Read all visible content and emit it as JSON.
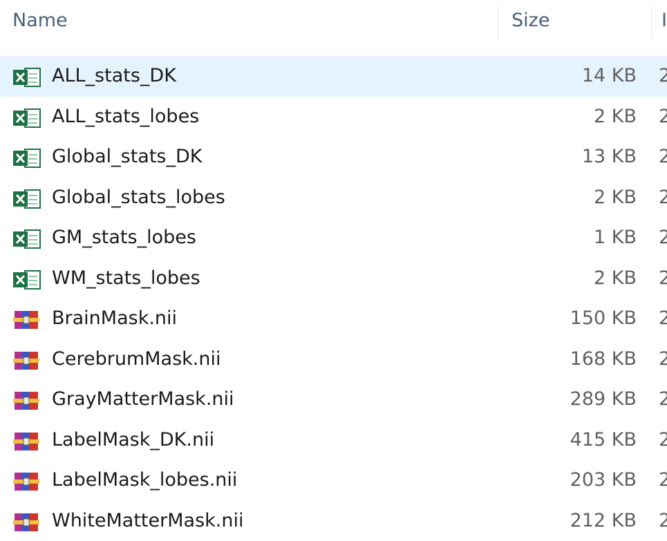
{
  "columns": {
    "name": "Name",
    "size": "Size",
    "date_modified_partial": "I"
  },
  "files": [
    {
      "name": "ALL_stats_DK",
      "size": "14 KB",
      "date_partial": "2",
      "icon": "excel-csv-icon",
      "selected": true
    },
    {
      "name": "ALL_stats_lobes",
      "size": "2 KB",
      "date_partial": "2",
      "icon": "excel-csv-icon",
      "selected": false
    },
    {
      "name": "Global_stats_DK",
      "size": "13 KB",
      "date_partial": "2",
      "icon": "excel-csv-icon",
      "selected": false
    },
    {
      "name": "Global_stats_lobes",
      "size": "2 KB",
      "date_partial": "2",
      "icon": "excel-csv-icon",
      "selected": false
    },
    {
      "name": "GM_stats_lobes",
      "size": "1 KB",
      "date_partial": "2",
      "icon": "excel-csv-icon",
      "selected": false
    },
    {
      "name": "WM_stats_lobes",
      "size": "2 KB",
      "date_partial": "2",
      "icon": "excel-csv-icon",
      "selected": false
    },
    {
      "name": "BrainMask.nii",
      "size": "150 KB",
      "date_partial": "2",
      "icon": "winrar-archive-icon",
      "selected": false
    },
    {
      "name": "CerebrumMask.nii",
      "size": "168 KB",
      "date_partial": "2",
      "icon": "winrar-archive-icon",
      "selected": false
    },
    {
      "name": "GrayMatterMask.nii",
      "size": "289 KB",
      "date_partial": "2",
      "icon": "winrar-archive-icon",
      "selected": false
    },
    {
      "name": "LabelMask_DK.nii",
      "size": "415 KB",
      "date_partial": "2",
      "icon": "winrar-archive-icon",
      "selected": false
    },
    {
      "name": "LabelMask_lobes.nii",
      "size": "203 KB",
      "date_partial": "2",
      "icon": "winrar-archive-icon",
      "selected": false
    },
    {
      "name": "WhiteMatterMask.nii",
      "size": "212 KB",
      "date_partial": "2",
      "icon": "winrar-archive-icon",
      "selected": false
    }
  ],
  "colors": {
    "selection": "#e5f3ff",
    "header_text": "#4c607a",
    "excel_green": "#1e7145",
    "winrar_red": "#c0392b"
  }
}
